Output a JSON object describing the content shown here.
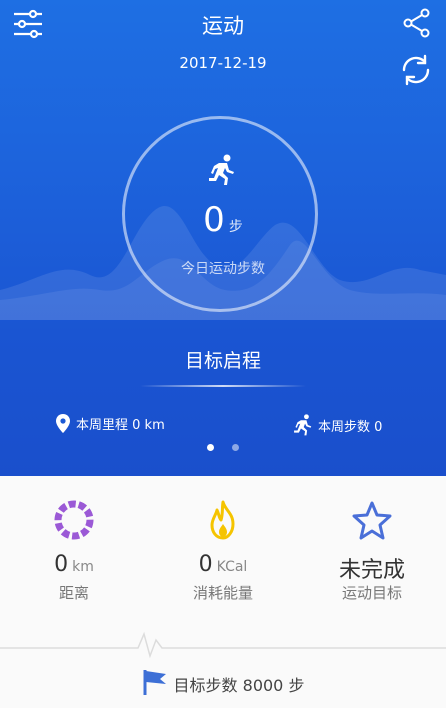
{
  "header": {
    "title": "运动",
    "date": "2017-12-19"
  },
  "today": {
    "steps_value": "0",
    "steps_unit": "步",
    "steps_label": "今日运动步数"
  },
  "goal_start_label": "目标启程",
  "weekly": {
    "distance_label": "本周里程 0 km",
    "steps_label": "本周步数 0"
  },
  "pager": {
    "pages": 2,
    "active": 1
  },
  "stats": {
    "distance": {
      "value": "0",
      "unit": "km",
      "label": "距离"
    },
    "energy": {
      "value": "0",
      "unit": "KCal",
      "label": "消耗能量"
    },
    "goal": {
      "value": "未完成",
      "label": "运动目标"
    }
  },
  "footer": {
    "goal_steps_label": "目标步数 8000 步"
  },
  "colors": {
    "hero_blue": "#1d63dc",
    "distance_purple": "#9b59d6",
    "energy_yellow": "#f5c400",
    "goal_blue": "#4a6fd8"
  },
  "icons": {
    "menu": "settings-sliders-icon",
    "share": "share-icon",
    "refresh": "sync-icon",
    "runner": "runner-icon",
    "location": "location-pin-icon",
    "distance": "ring-icon",
    "energy": "flame-icon",
    "goal": "star-icon",
    "flag": "flag-icon"
  }
}
